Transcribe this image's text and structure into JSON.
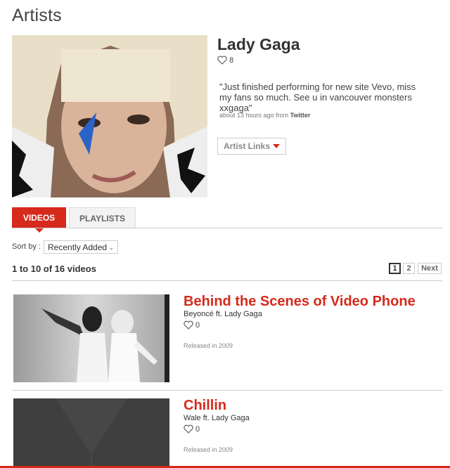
{
  "page": {
    "title": "Artists"
  },
  "artist": {
    "name": "Lady Gaga",
    "likes": "8",
    "tweet": "\"Just finished performing for new site Vevo, miss my fans so much. See u in vancouver monsters xxgaga\"",
    "tweet_time": "about 13 hours ago from ",
    "tweet_source": "Twitter",
    "links_label": "Artist Links"
  },
  "tabs": [
    {
      "label": "VIDEOS",
      "active": true
    },
    {
      "label": "PLAYLISTS",
      "active": false
    }
  ],
  "sort": {
    "label": "Sort by :",
    "value": "Recently Added"
  },
  "results": {
    "summary": "1 to 10 of 16 videos",
    "pages": [
      "1",
      "2"
    ],
    "next_label": "Next",
    "current_page": "1"
  },
  "videos": [
    {
      "title": "Behind the Scenes of Video Phone",
      "artist": "Beyoncé ft. Lady Gaga",
      "likes": "0",
      "released": "Released in 2009"
    },
    {
      "title": "Chillin",
      "artist": "Wale ft. Lady Gaga",
      "likes": "0",
      "released": "Released in 2009"
    }
  ],
  "colors": {
    "accent": "#d52a1c",
    "text": "#333333",
    "border": "#cccccc"
  },
  "icons": {
    "like": "heart-outline-icon",
    "dropdown": "caret-down-icon"
  }
}
